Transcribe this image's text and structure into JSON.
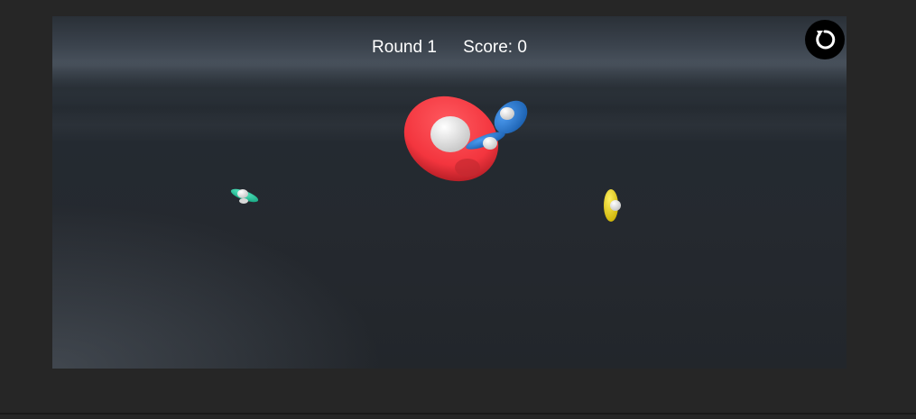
{
  "hud": {
    "round_label": "Round 1",
    "score_label": "Score: 0"
  },
  "controls": {
    "restart_icon": "restart-icon",
    "restart_button_color": "#000000"
  },
  "targets": [
    {
      "name": "red-ufo",
      "color": "#f3353e"
    },
    {
      "name": "blue-ufo",
      "color": "#2a7fd6"
    },
    {
      "name": "teal-ufo",
      "color": "#2fd3a8"
    },
    {
      "name": "yellow-ufo",
      "color": "#f2dc1a"
    }
  ]
}
